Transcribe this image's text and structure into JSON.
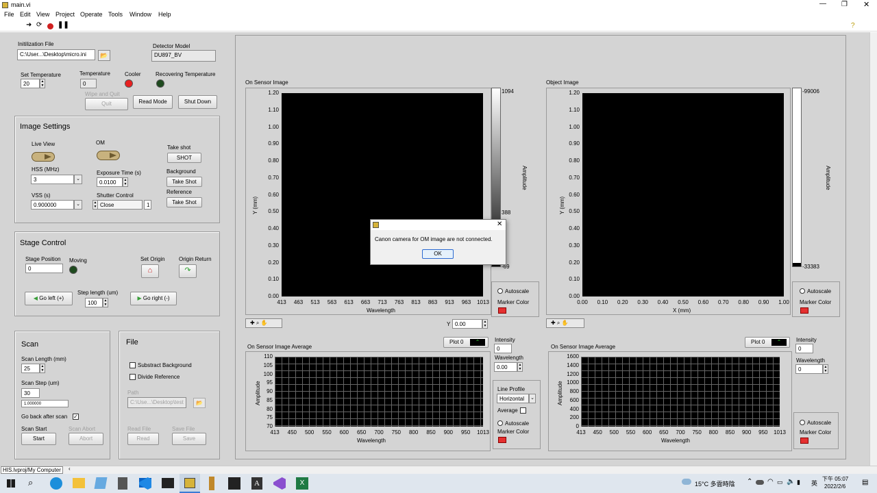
{
  "window": {
    "title": "main.vi"
  },
  "menu": [
    "File",
    "Edit",
    "View",
    "Project",
    "Operate",
    "Tools",
    "Window",
    "Help"
  ],
  "init": {
    "label": "Initilization File",
    "path": "C:\\User...\\Desktop\\micro.ini"
  },
  "detector": {
    "label": "Detector Model",
    "value": "DU897_BV"
  },
  "temp": {
    "set_label": "Set Temperature",
    "set_value": "20",
    "temp_label": "Temperature",
    "temp_value": "0",
    "cooler_label": "Cooler",
    "recover_label": "Recovering Temperature",
    "wipe_label": "Wipe and Quit",
    "quit": "Quit",
    "read_mode": "Read Mode",
    "shut_down": "Shut Down"
  },
  "image_settings": {
    "title": "Image Settings",
    "live_view": "Live View",
    "om": "OM",
    "take_shot": "Take shot",
    "shot": "SHOT",
    "hss_label": "HSS (MHz)",
    "hss_value": "3",
    "exposure_label": "Exposure Time (s)",
    "exposure_value": "0.0100",
    "background": "Background",
    "take_shot_btn": "Take Shot",
    "vss_label": "VSS (s)",
    "vss_value": "0.900000",
    "shutter_label": "Shutter Control",
    "shutter_value": "Close",
    "shutter_num": "1",
    "reference": "Reference",
    "take_shot_btn2": "Take Shot"
  },
  "stage": {
    "title": "Stage Control",
    "position_label": "Stage Position",
    "position_value": "0",
    "moving": "Moving",
    "set_origin": "Set Origin",
    "origin_return": "Origin Return",
    "go_left": "Go left (+)",
    "step_label": "Step length (um)",
    "step_value": "100",
    "go_right": "Go right (-)"
  },
  "scan": {
    "title": "Scan",
    "length_label": "Scan Length (mm)",
    "length_value": "25",
    "step_label": "Scan Step (um)",
    "step_value": "30",
    "step_sub": "1.000000",
    "go_back": "Go back after scan",
    "start_label": "Scan Start",
    "start": "Start",
    "abort_label": "Scan Abort",
    "abort": "Abort"
  },
  "file": {
    "title": "File",
    "subtract": "Substract Background",
    "divide": "Divide Reference",
    "path_label": "Path",
    "path_value": "C:\\Use...\\Desktop\\test",
    "read_label": "Read File",
    "read": "Read",
    "save_label": "Save File",
    "save": "Save"
  },
  "sensor_image": {
    "title": "On Sensor Image",
    "xlabel": "Wavelength",
    "ylabel": "Y (mm)",
    "xticks": [
      "413",
      "463",
      "513",
      "563",
      "613",
      "663",
      "713",
      "763",
      "813",
      "863",
      "913",
      "963",
      "1013"
    ],
    "yticks": [
      "1.20",
      "1.10",
      "1.00",
      "0.90",
      "0.80",
      "0.70",
      "0.60",
      "0.50",
      "0.40",
      "0.30",
      "0.20",
      "0.10",
      "0.00"
    ],
    "scale": [
      "1094",
      "388",
      "-69"
    ],
    "amp": "Amplitude",
    "autoscale": "Autoscale",
    "marker": "Marker Color",
    "y_label": "Y",
    "y_value": "0.00"
  },
  "object_image": {
    "title": "Object Image",
    "xlabel": "X (mm)",
    "ylabel": "Y (mm)",
    "xticks": [
      "0.00",
      "0.10",
      "0.20",
      "0.30",
      "0.40",
      "0.50",
      "0.60",
      "0.70",
      "0.80",
      "0.90",
      "1.00"
    ],
    "yticks": [
      "1.20",
      "1.10",
      "1.00",
      "0.90",
      "0.80",
      "0.70",
      "0.60",
      "0.50",
      "0.40",
      "0.30",
      "0.20",
      "0.10",
      "0.00"
    ],
    "scale": [
      "-99006",
      "-33383"
    ],
    "amp": "Amplitude",
    "autoscale": "Autoscale",
    "marker": "Marker Color"
  },
  "avg1": {
    "title": "On Sensor Image Average",
    "plot": "Plot 0",
    "xlabel": "Wavelength",
    "ylabel": "Amplitude",
    "xticks": [
      "413",
      "450",
      "500",
      "550",
      "600",
      "650",
      "700",
      "750",
      "800",
      "850",
      "900",
      "950",
      "1013"
    ],
    "yticks": [
      "110",
      "105",
      "100",
      "95",
      "90",
      "85",
      "80",
      "75",
      "70"
    ],
    "intensity_label": "Intensity",
    "intensity_value": "0",
    "wave_label": "Wavelength",
    "wave_value": "0.00",
    "line_profile": "Line Profile",
    "profile_value": "Horizontal",
    "average": "Average",
    "autoscale": "Autoscale",
    "marker": "Marker Color"
  },
  "avg2": {
    "title": "On Sensor Image Average",
    "plot": "Plot 0",
    "xlabel": "Wavelength",
    "ylabel": "Amplitude",
    "xticks": [
      "413",
      "450",
      "500",
      "550",
      "600",
      "650",
      "700",
      "750",
      "800",
      "850",
      "900",
      "950",
      "1013"
    ],
    "yticks": [
      "1600",
      "1400",
      "1200",
      "1000",
      "800",
      "600",
      "400",
      "200",
      "0"
    ],
    "intensity_label": "Intensity",
    "intensity_value": "0",
    "wave_label": "Wavelength",
    "wave_value": "0",
    "autoscale": "Autoscale",
    "marker": "Marker Color"
  },
  "dialog": {
    "message": "Canon camera for OM image are not connected.",
    "ok": "OK"
  },
  "status": {
    "path": "HIS.lvproj/My Computer"
  },
  "taskbar": {
    "weather": "15°C 多雲時陰",
    "time": "下午 05:07",
    "date": "2022/2/6",
    "ime": "英"
  }
}
